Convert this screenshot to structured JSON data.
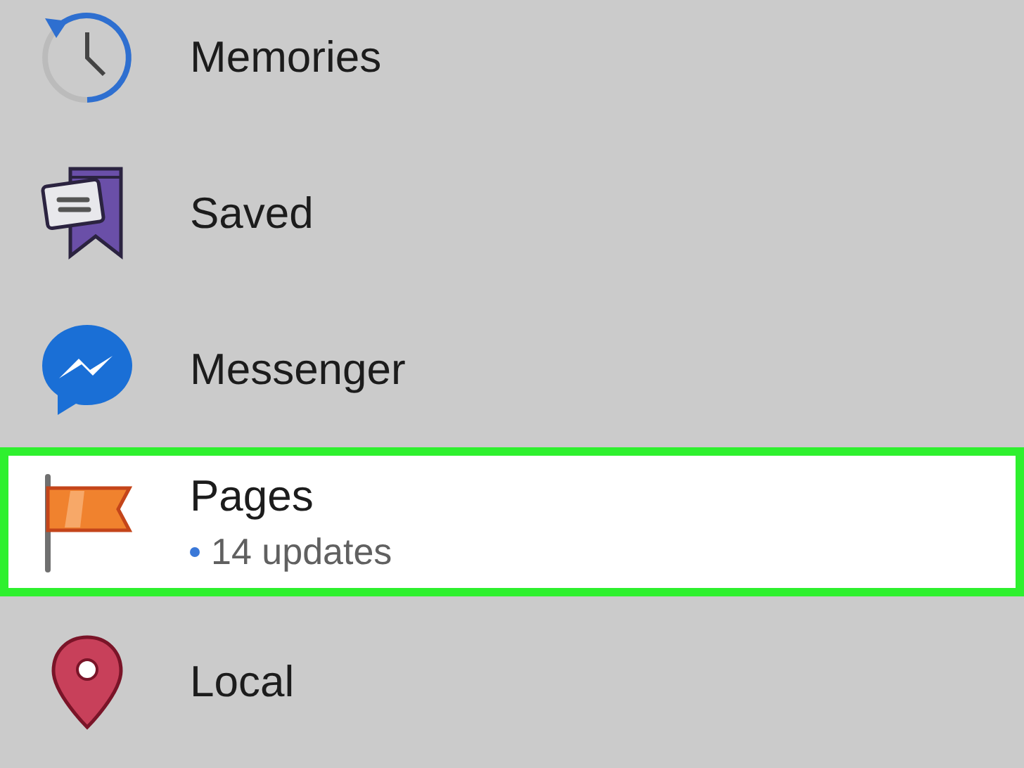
{
  "menu": {
    "items": [
      {
        "kind": "clock",
        "label": "Memories",
        "selected": false
      },
      {
        "kind": "bookmark",
        "label": "Saved",
        "selected": false
      },
      {
        "kind": "messenger",
        "label": "Messenger",
        "selected": false
      },
      {
        "kind": "flag",
        "label": "Pages",
        "subtitle": "14 updates",
        "selected": true
      },
      {
        "kind": "pin",
        "label": "Local",
        "selected": false
      }
    ]
  }
}
